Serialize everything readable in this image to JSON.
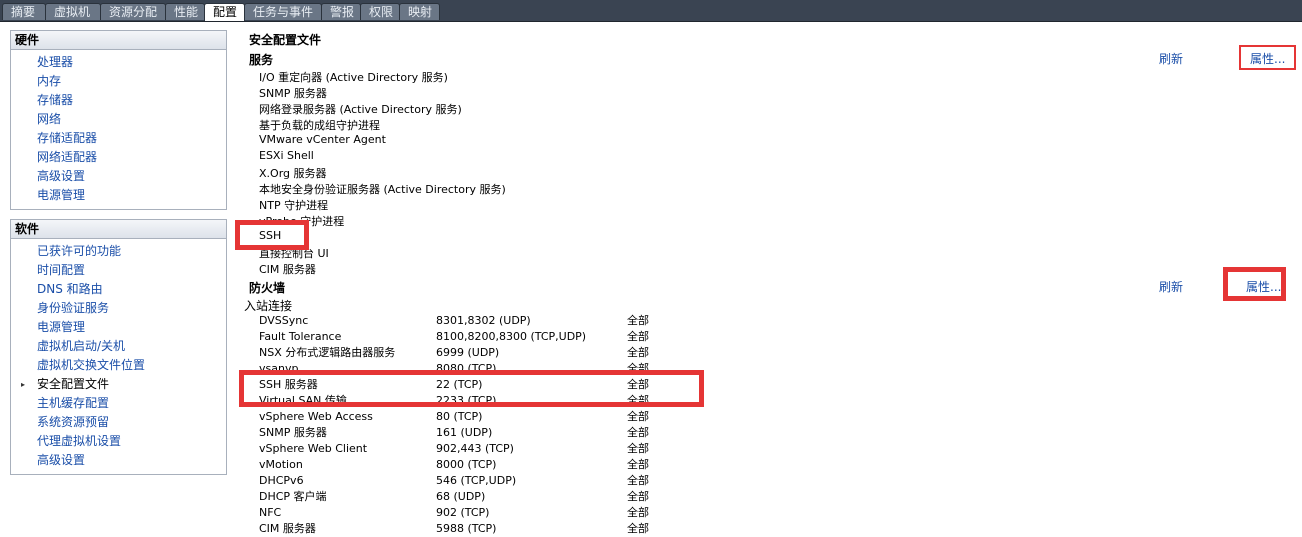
{
  "tabs": [
    "摘要",
    "虚拟机",
    "资源分配",
    "性能",
    "配置",
    "任务与事件",
    "警报",
    "权限",
    "映射"
  ],
  "active_tab": "配置",
  "hardware": {
    "title": "硬件",
    "items": [
      "处理器",
      "内存",
      "存储器",
      "网络",
      "存储适配器",
      "网络适配器",
      "高级设置",
      "电源管理"
    ]
  },
  "software": {
    "title": "软件",
    "items": [
      "已获许可的功能",
      "时间配置",
      "DNS 和路由",
      "身份验证服务",
      "电源管理",
      "虚拟机启动/关机",
      "虚拟机交换文件位置",
      "安全配置文件",
      "主机缓存配置",
      "系统资源预留",
      "代理虚拟机设置",
      "高级设置"
    ],
    "current": "安全配置文件"
  },
  "main": {
    "title": "安全配置文件",
    "services": {
      "title": "服务",
      "refresh": "刷新",
      "properties": "属性...",
      "items": [
        "I/O 重定向器 (Active Directory 服务)",
        "SNMP 服务器",
        "网络登录服务器 (Active Directory 服务)",
        "基于负载的成组守护进程",
        "VMware vCenter Agent",
        "ESXi Shell",
        "X.Org 服务器",
        "本地安全身份验证服务器 (Active Directory 服务)",
        "NTP 守护进程",
        "vProbe 守护进程",
        "SSH",
        "直接控制台 UI",
        "CIM 服务器"
      ]
    },
    "firewall": {
      "title": "防火墙",
      "refresh": "刷新",
      "properties": "属性...",
      "incoming": "入站连接",
      "rows": [
        [
          "DVSSync",
          "8301,8302 (UDP)",
          "全部"
        ],
        [
          "Fault Tolerance",
          "8100,8200,8300 (TCP,UDP)",
          "全部"
        ],
        [
          "NSX 分布式逻辑路由器服务",
          "6999 (UDP)",
          "全部"
        ],
        [
          "vsanvp",
          "8080 (TCP)",
          "全部"
        ],
        [
          "SSH 服务器",
          "22 (TCP)",
          "全部"
        ],
        [
          "Virtual SAN 传输",
          "2233 (TCP)",
          "全部"
        ],
        [
          "vSphere Web Access",
          "80 (TCP)",
          "全部"
        ],
        [
          "SNMP 服务器",
          "161 (UDP)",
          "全部"
        ],
        [
          "vSphere Web Client",
          "902,443 (TCP)",
          "全部"
        ],
        [
          "vMotion",
          "8000 (TCP)",
          "全部"
        ],
        [
          "DHCPv6",
          "546 (TCP,UDP)",
          "全部"
        ],
        [
          "DHCP 客户端",
          "68 (UDP)",
          "全部"
        ],
        [
          "NFC",
          "902 (TCP)",
          "全部"
        ],
        [
          "CIM 服务器",
          "5988 (TCP)",
          "全部"
        ]
      ]
    }
  },
  "colors": {
    "highlight": "#e53535",
    "link": "#1a4ea8",
    "tabbar": "#3a4452"
  }
}
